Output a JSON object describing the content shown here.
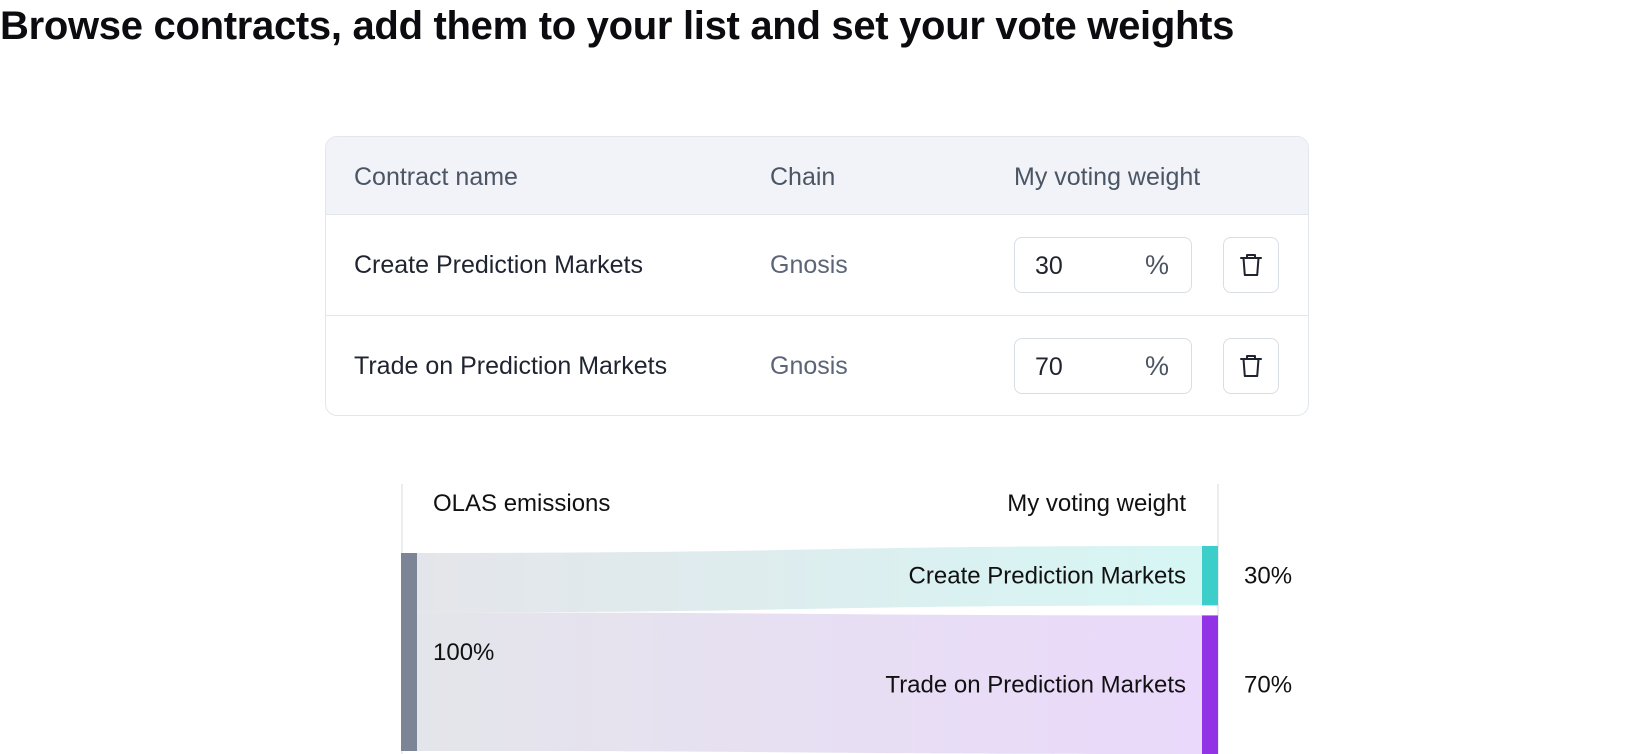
{
  "title": "Browse contracts, add them to your list and set your vote weights",
  "table": {
    "headers": {
      "name": "Contract name",
      "chain": "Chain",
      "weight": "My voting weight"
    },
    "rows": [
      {
        "name": "Create Prediction Markets",
        "chain": "Gnosis",
        "weight": "30",
        "unit": "%"
      },
      {
        "name": "Trade on Prediction Markets",
        "chain": "Gnosis",
        "weight": "70",
        "unit": "%"
      }
    ]
  },
  "sankey": {
    "left_header": "OLAS emissions",
    "right_header": "My voting weight",
    "source_label": "100%",
    "source_color": "#7b8596",
    "flows": [
      {
        "label": "Create Prediction Markets",
        "value": 30,
        "value_label": "30%",
        "color": "#3ccfc9"
      },
      {
        "label": "Trade on Prediction Markets",
        "value": 70,
        "value_label": "70%",
        "color": "#9233e6"
      }
    ]
  },
  "icons": {
    "delete": "trash-icon"
  }
}
